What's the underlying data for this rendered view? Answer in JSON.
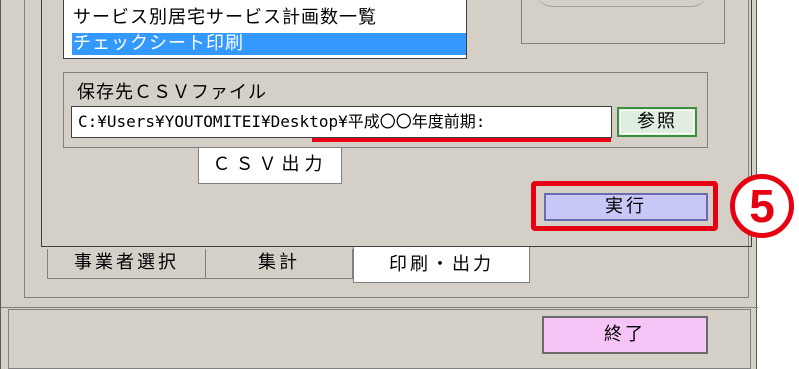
{
  "service_list": {
    "items": [
      {
        "label": "サービス別居宅サービス計画数一覧",
        "selected": false
      },
      {
        "label": "チェックシート印刷",
        "selected": true
      }
    ]
  },
  "csv_save": {
    "title": "保存先ＣＳＶファイル",
    "path": "C:¥Users¥YOUTOMITEI¥Desktop¥平成〇〇年度前期:",
    "browse_label": "参照"
  },
  "subtabs": {
    "csv_output": "ＣＳＶ出力"
  },
  "execute_label": "実行",
  "step_marker": "5",
  "tabs": [
    {
      "label": "事業者選択",
      "active": false
    },
    {
      "label": "集計",
      "active": false
    },
    {
      "label": "印刷・出力",
      "active": true
    }
  ],
  "end_label": "終了",
  "colors": {
    "highlight": "#e60012",
    "selection": "#3399ff",
    "execute_bg": "#c8c8f6",
    "end_bg": "#f7c4f7",
    "browse_border": "#3c8f3c"
  }
}
